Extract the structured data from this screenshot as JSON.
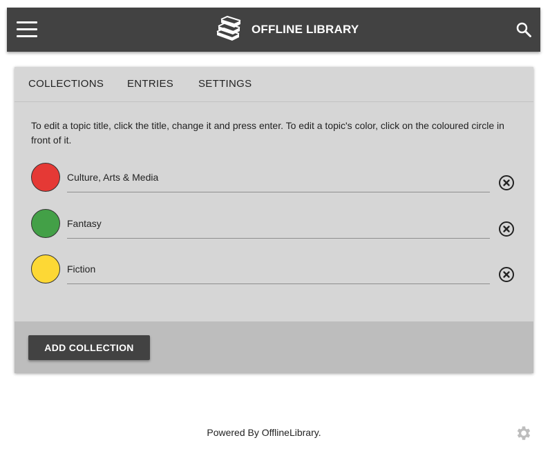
{
  "app": {
    "title": "OFFLINE LIBRARY",
    "logo_icon": "books-stack-icon",
    "menu_icon": "hamburger-menu-icon",
    "search_icon": "search-icon",
    "bar_color": "#424242"
  },
  "tabs": [
    {
      "label": "COLLECTIONS"
    },
    {
      "label": "ENTRIES"
    },
    {
      "label": "SETTINGS"
    }
  ],
  "main": {
    "instructions": "To edit a topic title, click the title, change it and press enter. To edit a topic's color, click on the coloured circle in front of it.",
    "collections": [
      {
        "title": "Culture, Arts & Media",
        "color": "#e53935"
      },
      {
        "title": "Fantasy",
        "color": "#43a047"
      },
      {
        "title": "Fiction",
        "color": "#fdd835"
      }
    ],
    "remove_icon": "circle-x-icon",
    "add_button_label": "ADD COLLECTION"
  },
  "footer": {
    "text": "Powered By OfflineLibrary.",
    "settings_icon": "gear-icon"
  }
}
